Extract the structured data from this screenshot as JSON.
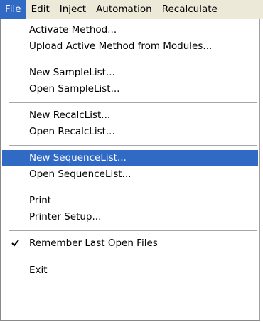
{
  "menubar": {
    "items": [
      "File",
      "Edit",
      "Inject",
      "Automation",
      "Recalculate"
    ]
  },
  "file_menu": {
    "items": [
      {
        "label": "Activate Method..."
      },
      {
        "label": "Upload Active Method from Modules..."
      },
      {
        "label": "New SampleList..."
      },
      {
        "label": "Open SampleList..."
      },
      {
        "label": "New RecalcList..."
      },
      {
        "label": "Open RecalcList..."
      },
      {
        "label": "New SequenceList..."
      },
      {
        "label": "Open SequenceList..."
      },
      {
        "label": "Print"
      },
      {
        "label": "Printer Setup..."
      },
      {
        "label": "Remember Last Open Files"
      },
      {
        "label": "Exit"
      }
    ],
    "highlighted_item": "New SequenceList...",
    "checked_item": "Remember Last Open Files",
    "check_icon": "checkmark-icon",
    "highlight_color": "#316ac5"
  }
}
